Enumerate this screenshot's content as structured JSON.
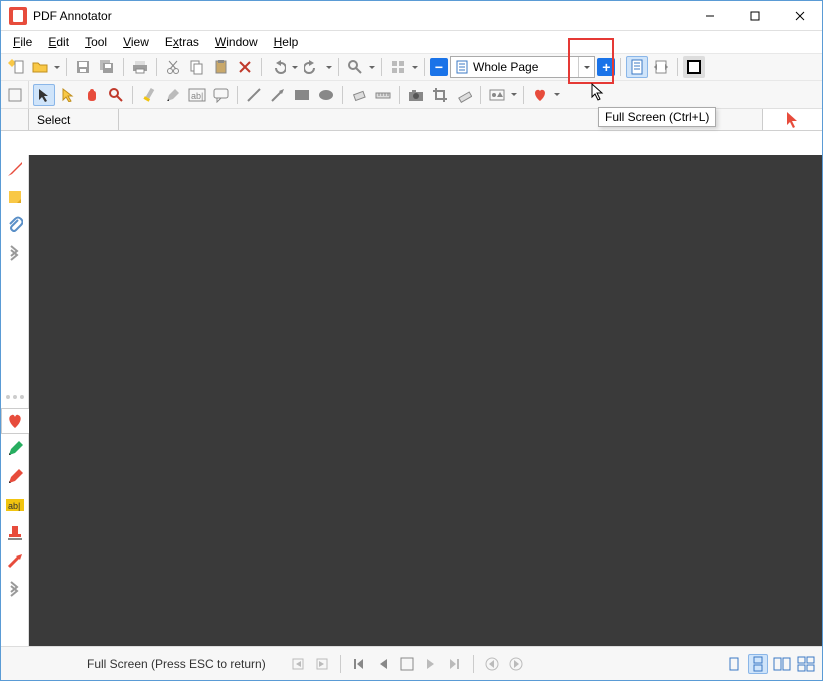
{
  "app": {
    "title": "PDF Annotator"
  },
  "menu": {
    "file": "File",
    "edit": "Edit",
    "tool": "Tool",
    "view": "View",
    "extras": "Extras",
    "window": "Window",
    "help": "Help"
  },
  "toolbar": {
    "zoom_label": "Whole Page"
  },
  "tooltip": {
    "fullscreen": "Full Screen (Ctrl+L)"
  },
  "toolRow": {
    "select_label": "Select"
  },
  "status": {
    "hint": "Full Screen (Press ESC to return)"
  },
  "icons": {
    "new": "new-document-icon",
    "open": "open-folder-icon",
    "save": "save-icon",
    "saveall": "save-all-icon",
    "print": "print-icon",
    "cut": "cut-icon",
    "copy": "copy-icon",
    "paste": "paste-icon",
    "delete": "delete-icon",
    "undo": "undo-icon",
    "redo": "redo-icon",
    "find": "find-icon",
    "favorites": "favorites-icon",
    "zoomout": "zoom-out-icon",
    "zoomin": "zoom-in-icon",
    "singlepage": "single-page-icon",
    "fitwidth": "fit-width-icon",
    "fullscreen": "fullscreen-icon",
    "pointer": "pointer-icon",
    "pan": "pan-icon",
    "eraser-red": "eraser-tool-icon",
    "magnifier": "magnifier-icon",
    "marker": "marker-icon",
    "pencil": "pencil-icon",
    "textbox": "textbox-icon",
    "textcloud": "text-cloud-icon",
    "line": "line-icon",
    "arrow": "arrow-icon",
    "rect": "rectangle-icon",
    "ellipse": "ellipse-icon",
    "eraser": "eraser-icon",
    "ruler": "ruler-icon",
    "camera": "camera-icon",
    "crop": "crop-icon",
    "dim": "dimension-icon",
    "heart": "heart-icon"
  }
}
